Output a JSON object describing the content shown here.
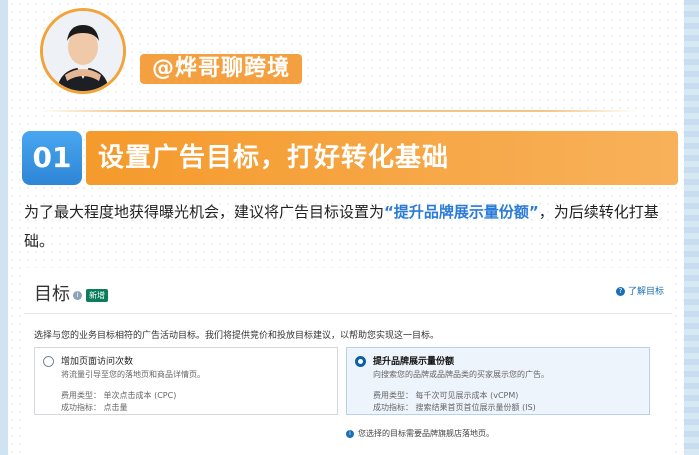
{
  "colors": {
    "accent_orange": "#f5a040",
    "accent_blue": "#2d86d6",
    "highlight_text": "#2a7bd7"
  },
  "header": {
    "author_handle": "@烨哥聊跨境"
  },
  "section": {
    "number": "01",
    "title": "设置广告目标，打好转化基础"
  },
  "paragraph": {
    "before": "为了最大程度地获得曝光机会，建议将广告目标设置为",
    "highlight": "“提升品牌展示量份额”",
    "after": "，为后续转化打基础。"
  },
  "goal_panel": {
    "title": "目标",
    "new_badge": "新增",
    "learn_link": "了解目标",
    "intro": "选择与您的业务目标相符的广告活动目标。我们将提供竞价和投放目标建议，以帮助您实现这一目标。",
    "options": [
      {
        "title": "增加页面访问次数",
        "desc": "将流量引导至您的落地页和商品详情页。",
        "cost_type": "费用类型：  单次点击成本 (CPC)",
        "metric": "成功指标：  点击量",
        "selected": false
      },
      {
        "title": "提升品牌展示量份额",
        "desc": "向搜索您的品牌或品牌品类的买家展示您的广告。",
        "cost_type": "费用类型：  每千次可见展示成本 (vCPM)",
        "metric": "成功指标：  搜索结果首页首位展示量份额 (IS)",
        "selected": true
      }
    ],
    "note": "您选择的目标需要品牌旗舰店落地页。"
  }
}
